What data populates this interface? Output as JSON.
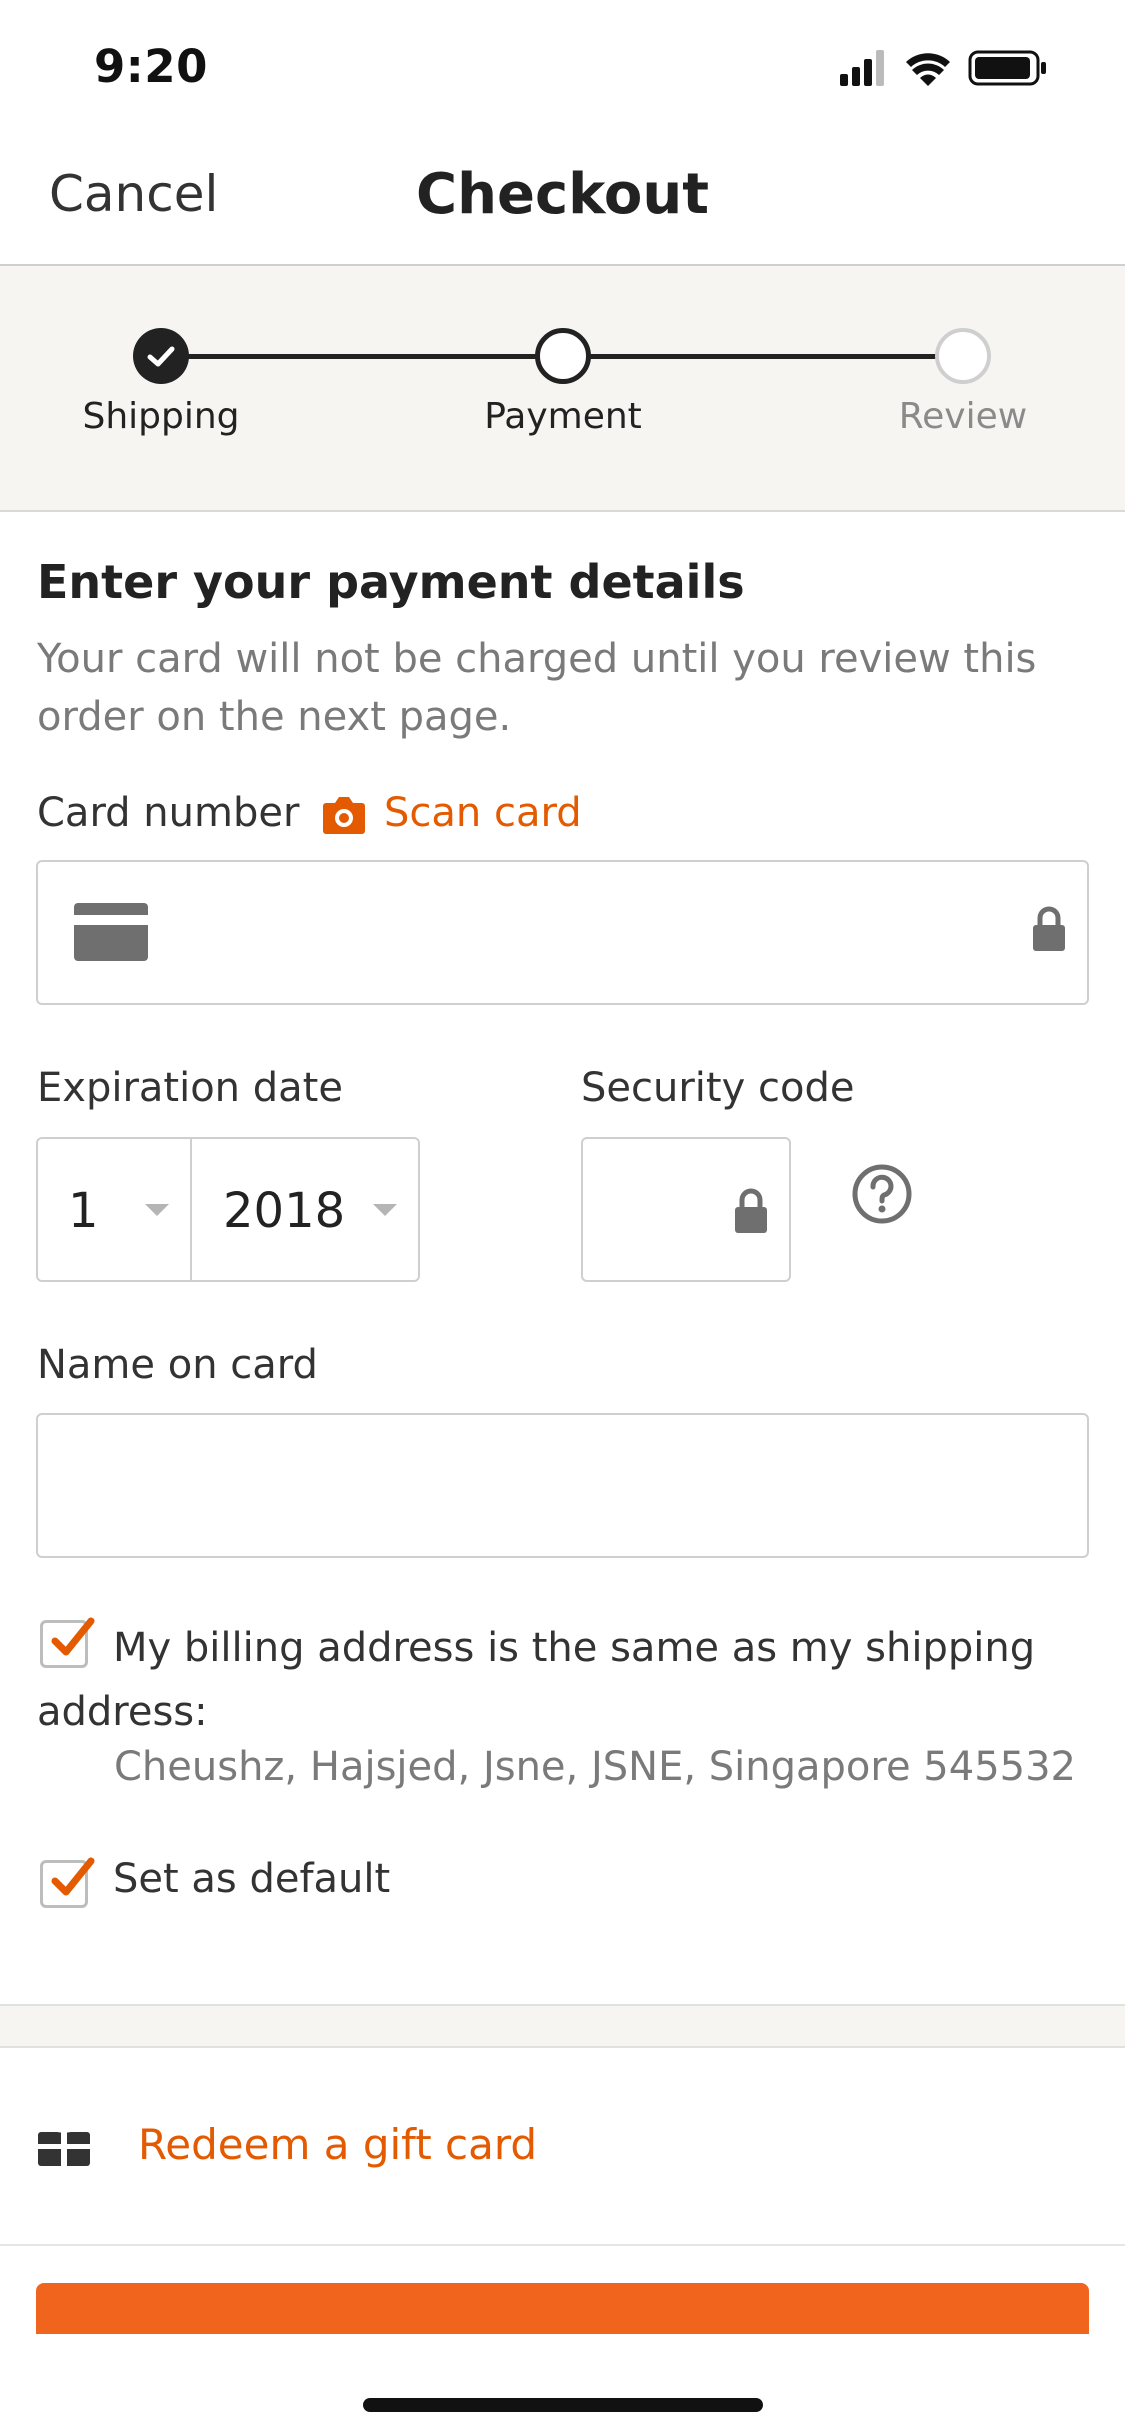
{
  "status_bar": {
    "time": "9:20"
  },
  "nav": {
    "cancel_label": "Cancel",
    "title": "Checkout"
  },
  "stepper": {
    "steps": [
      {
        "label": "Shipping",
        "state": "done"
      },
      {
        "label": "Payment",
        "state": "current"
      },
      {
        "label": "Review",
        "state": "future"
      }
    ]
  },
  "payment": {
    "heading": "Enter your payment details",
    "subtext": "Your card will not be charged until you review this order on the next page.",
    "card_number_label": "Card number",
    "scan_card_label": "Scan card",
    "card_number_value": "",
    "expiration_label": "Expiration date",
    "exp_month": "1",
    "exp_year": "2018",
    "security_label": "Security code",
    "security_value": "",
    "name_label": "Name on card",
    "name_value": "",
    "billing_same_label": "My billing address is the same as my shipping address:",
    "billing_same_checked": true,
    "shipping_address": "Cheushz, Hajsjed, Jsne, JSNE, Singapore 545532",
    "set_default_label": "Set as default",
    "set_default_checked": true
  },
  "gift": {
    "label": "Redeem a gift card"
  },
  "colors": {
    "accent": "#e35a00",
    "button": "#f1641e",
    "text": "#222222",
    "muted": "#7a7a7a",
    "stepper_bg": "#f6f5f2"
  },
  "icons": [
    "signal-icon",
    "wifi-icon",
    "battery-icon",
    "camera-icon",
    "credit-card-icon",
    "lock-icon",
    "help-circle-icon",
    "checkmark-icon",
    "gift-icon"
  ]
}
